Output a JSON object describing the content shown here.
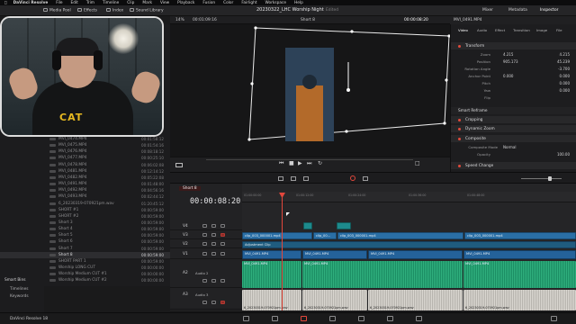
{
  "menubar": {
    "app_name": "DaVinci Resolve",
    "items": [
      "File",
      "Edit",
      "Trim",
      "Timeline",
      "Clip",
      "Mark",
      "View",
      "Playback",
      "Fusion",
      "Color",
      "Fairlight",
      "Workspace",
      "Help"
    ]
  },
  "topbar": {
    "media_pool": "Media Pool",
    "effects": "Effects",
    "index": "Index",
    "sound_library": "Sound Library",
    "project_title": "20230322_LHC Worship Night",
    "edited": "Edited",
    "mixer": "Mixer",
    "metadata": "Metadata",
    "inspector": "Inspector"
  },
  "viewer": {
    "zoom": "14%",
    "source_tc": "00:01:09:16",
    "timeline_name": "Short 8",
    "current_tc": "00:00:08:20",
    "clip_name": "MVI_0491.MP4"
  },
  "media_pool": {
    "rows": [
      {
        "name": "MVI_0474.MP4",
        "tc": "00:01:58:12",
        "selected": false
      },
      {
        "name": "MVI_0475.MP4",
        "tc": "00:01:54:16",
        "selected": false
      },
      {
        "name": "MVI_0476.MP4",
        "tc": "00:08:18:12",
        "selected": false
      },
      {
        "name": "MVI_0477.MP4",
        "tc": "00:00:25:10",
        "selected": false
      },
      {
        "name": "MVI_0478.MP4",
        "tc": "00:06:02:08",
        "selected": false
      },
      {
        "name": "MVI_0481.MP4",
        "tc": "00:12:14:12",
        "selected": false
      },
      {
        "name": "MVI_0482.MP4",
        "tc": "00:05:22:08",
        "selected": false
      },
      {
        "name": "MVI_0491.MP4",
        "tc": "00:01:48:00",
        "selected": false
      },
      {
        "name": "MVI_0492.MP4",
        "tc": "00:04:56:16",
        "selected": false
      },
      {
        "name": "MVI_0493.MP4",
        "tc": "00:02:44:12",
        "selected": false
      },
      {
        "name": "6_20230319-070921pm.wav",
        "tc": "01:20:45:12",
        "selected": false
      },
      {
        "name": "SHORT #1",
        "tc": "00:00:59:00",
        "selected": false
      },
      {
        "name": "SHORT #2",
        "tc": "00:00:59:00",
        "selected": false
      },
      {
        "name": "Short 3",
        "tc": "00:00:59:00",
        "selected": false
      },
      {
        "name": "Short 4",
        "tc": "00:00:59:00",
        "selected": false
      },
      {
        "name": "Short 5",
        "tc": "00:00:59:00",
        "selected": false
      },
      {
        "name": "Short 6",
        "tc": "00:00:59:00",
        "selected": false
      },
      {
        "name": "Short 7",
        "tc": "00:00:59:00",
        "selected": false
      },
      {
        "name": "Short 8",
        "tc": "00:00:59:00",
        "selected": true
      },
      {
        "name": "SHORT PART 1",
        "tc": "00:00:59:00",
        "selected": false
      },
      {
        "name": "Worship LONG CUT",
        "tc": "00:00:00:00",
        "selected": false
      },
      {
        "name": "Worship Medium CUT #1",
        "tc": "00:00:00:00",
        "selected": false
      },
      {
        "name": "Worship Medium CUT #2",
        "tc": "00:00:00:00",
        "selected": false
      }
    ]
  },
  "smart_bins": {
    "title": "Smart Bins",
    "items": [
      "Timelines",
      "Keywords"
    ]
  },
  "inspector": {
    "tabs": [
      "Video",
      "Audio",
      "Effect",
      "Transition",
      "Image",
      "File"
    ],
    "transform": {
      "title": "Transform",
      "zoom_label": "Zoom",
      "zoom_x": "4.215",
      "zoom_y": "4.215",
      "position_label": "Position",
      "position_x": "905.173",
      "position_y": "45.239",
      "rotation_label": "Rotation Angle",
      "rotation": "-3.700",
      "anchor_label": "Anchor Point",
      "anchor_x": "0.000",
      "anchor_y": "0.000",
      "pitch_label": "Pitch",
      "pitch": "0.000",
      "yaw_label": "Yaw",
      "yaw": "0.000",
      "flip_label": "Flip"
    },
    "smart_reframe": "Smart Reframe",
    "cropping": "Cropping",
    "dynamic_zoom": "Dynamic Zoom",
    "composite": {
      "title": "Composite",
      "mode_label": "Composite Mode",
      "mode_value": "Normal",
      "opacity_label": "Opacity",
      "opacity_value": "100.00"
    },
    "speed_change": "Speed Change"
  },
  "timeline": {
    "tab": "Short 8",
    "timecode": "00:00:08:20",
    "ruler_labels": [
      "01:00:00:00",
      "01:00:12:00",
      "01:00:24:00",
      "01:00:36:00",
      "01:00:48:00"
    ],
    "tracks": [
      {
        "id": "V4",
        "name": ""
      },
      {
        "id": "V3",
        "name": ""
      },
      {
        "id": "V2",
        "name": ""
      },
      {
        "id": "V1",
        "name": ""
      },
      {
        "id": "A2",
        "name": "Audio 2"
      },
      {
        "id": "A3",
        "name": "Audio 3"
      }
    ],
    "clips": {
      "v3_a": "clip_003_000001.mp4",
      "v3_b": "clip_00...",
      "v3_c": "clip_003_000001.mp4",
      "v3_d": "clip_003_000001.mp4",
      "adjustment": "Adjustment Clip",
      "v1_a": "MVI_0491.MP4",
      "v1_b": "MVI_0491.MP4",
      "v1_c": "MVI_0491.MP4",
      "v1_d": "MVI_0491.MP4",
      "a2_a": "MVI_0491.MP4",
      "a2_b": "MVI_0491.MP4",
      "a2_c": "MVI_0491.MP4",
      "a3_a": "6_20230319-070921pm.wav",
      "a3_b": "6_20230319-070921pm.wav",
      "a3_c": "6_20230319-070921pm.wav",
      "a3_d": "6_20230319-070921pm.wav"
    }
  },
  "status": {
    "app": "DaVinci Resolve 18"
  },
  "colors": {
    "playhead": "#e2473c",
    "video_clip": "#24629a",
    "audio_clip": "#2fb07e",
    "accent_dot": "#e24a3b"
  }
}
